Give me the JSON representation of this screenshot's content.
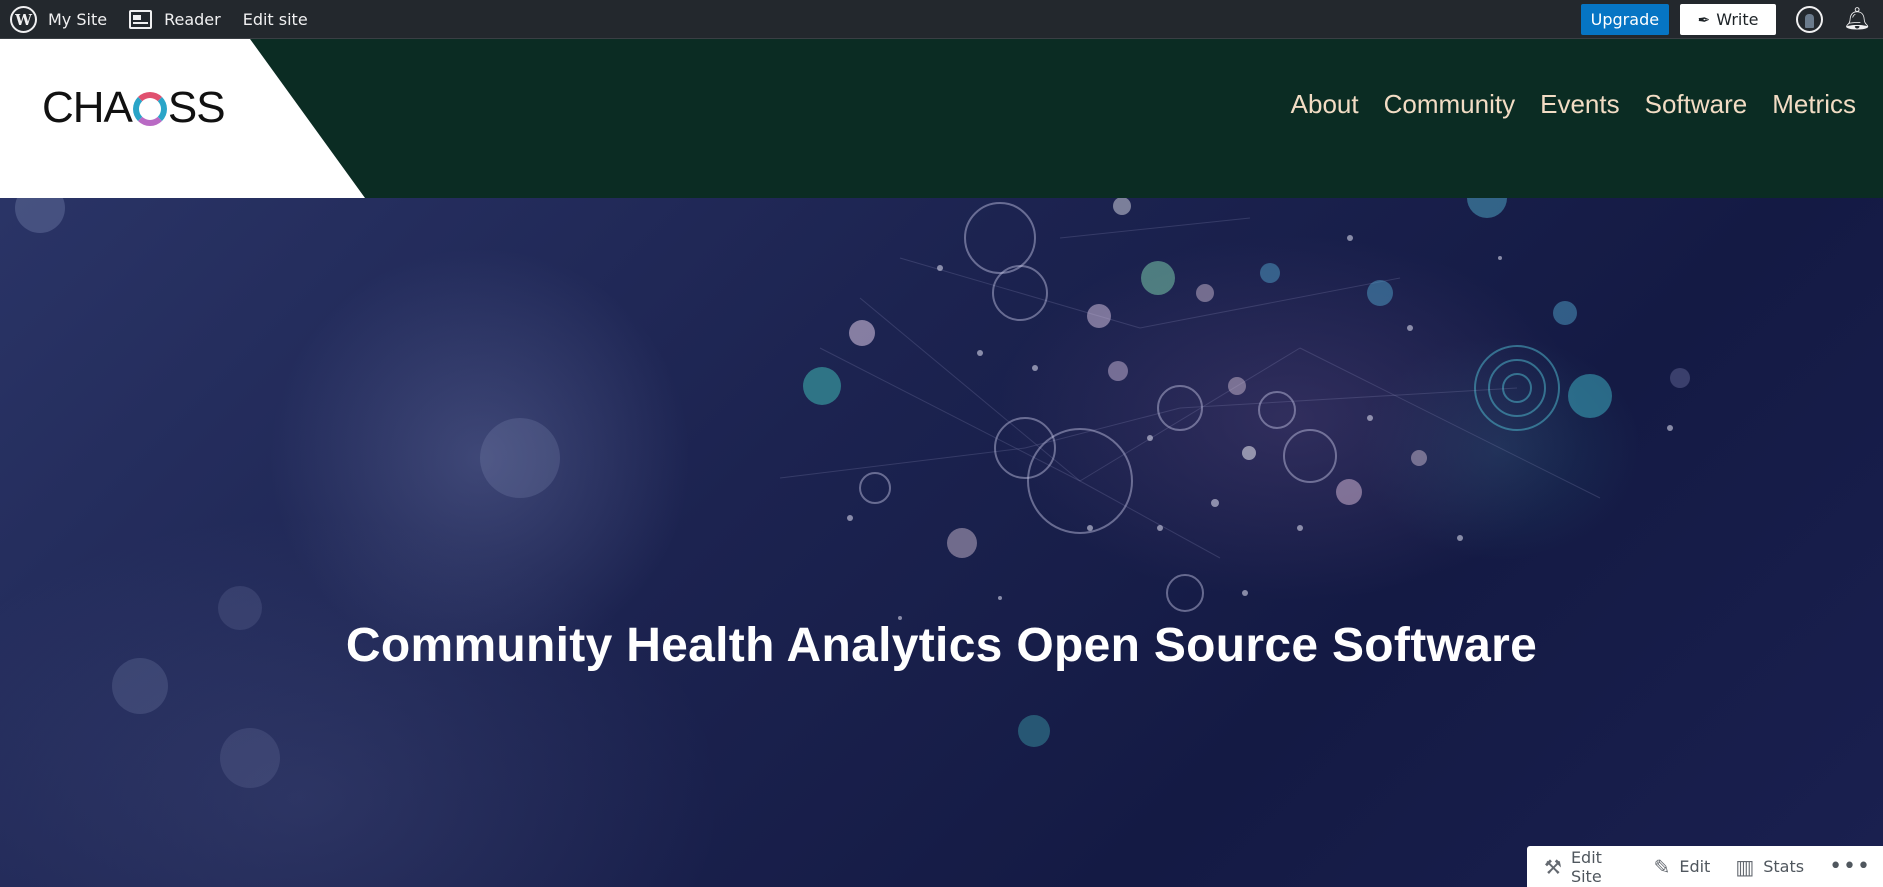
{
  "adminbar": {
    "my_site": "My Site",
    "reader": "Reader",
    "edit_site": "Edit site",
    "upgrade": "Upgrade",
    "write": "Write",
    "wp_logo": "W"
  },
  "header": {
    "logo_text_a": "CHA",
    "logo_text_b": "SS",
    "nav": [
      {
        "label": "About"
      },
      {
        "label": "Community"
      },
      {
        "label": "Events"
      },
      {
        "label": "Software"
      },
      {
        "label": "Metrics"
      }
    ]
  },
  "hero": {
    "title": "Community Health Analytics Open Source Software"
  },
  "toolbar": {
    "edit_site": "Edit Site",
    "edit": "Edit",
    "stats": "Stats",
    "more": "•••"
  },
  "colors": {
    "adminbar_bg": "#23282d",
    "upgrade_blue": "#0675c4",
    "header_green": "#0b2c23",
    "nav_text": "#f2dcc4",
    "hero_bg": "#1c2350"
  },
  "icons": [
    "wordpress-logo-icon",
    "reader-icon",
    "pen-icon",
    "avatar-icon",
    "bell-icon",
    "tools-icon",
    "pencil-icon",
    "stats-icon",
    "more-icon"
  ]
}
